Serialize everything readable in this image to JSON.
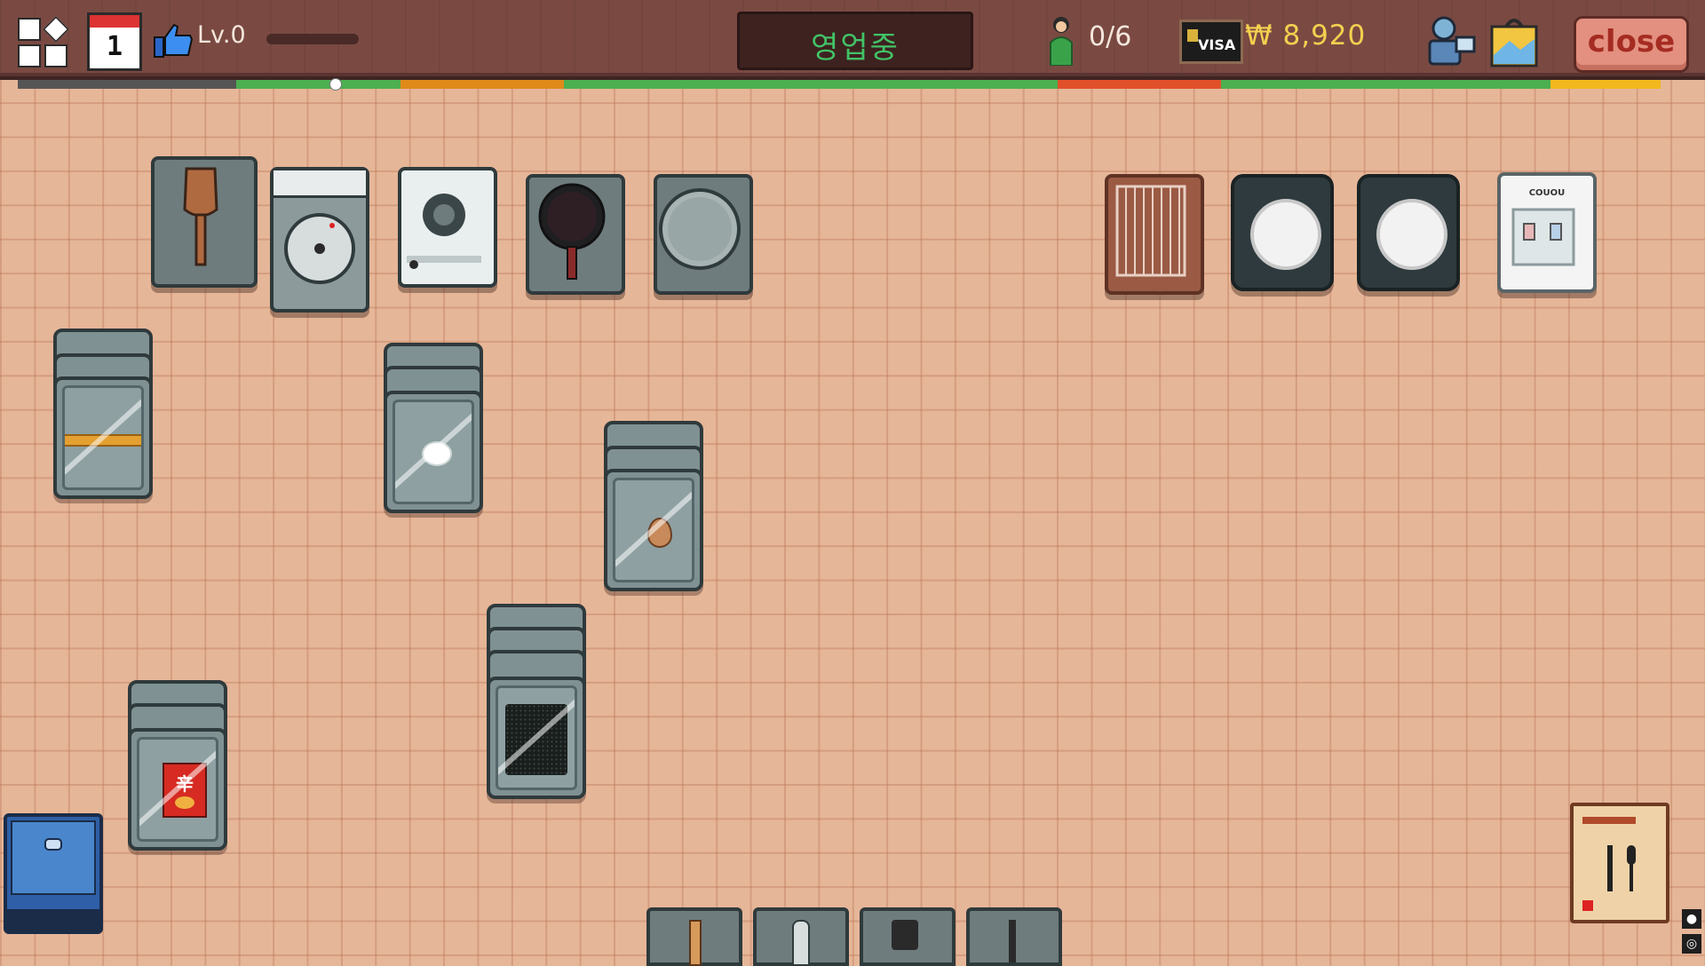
{
  "hud": {
    "calendar_day": "1",
    "level_label": "Lv.0",
    "xp_fraction": 0.0,
    "status": "영업중",
    "customers": "0/6",
    "card_label": "VISA",
    "money": "₩ 8,920",
    "close_label": "close"
  },
  "timeline": {
    "marker_position": 0.19,
    "segments": [
      {
        "color": "#555555",
        "fraction": 0.131
      },
      {
        "color": "#4caf50",
        "fraction": 0.098
      },
      {
        "color": "#e08a1a",
        "fraction": 0.098
      },
      {
        "color": "#4caf50",
        "fraction": 0.296
      },
      {
        "color": "#e0502a",
        "fraction": 0.098
      },
      {
        "color": "#4caf50",
        "fraction": 0.197
      },
      {
        "color": "#f2b81e",
        "fraction": 0.066
      }
    ]
  },
  "stations": {
    "ramen_label": "辛",
    "water_dispenser_brand": "COUOU"
  },
  "colors": {
    "floor": "#e6b698",
    "topbar": "#7a4a42",
    "status_green": "#42c266",
    "money_yellow": "#f4d050"
  }
}
